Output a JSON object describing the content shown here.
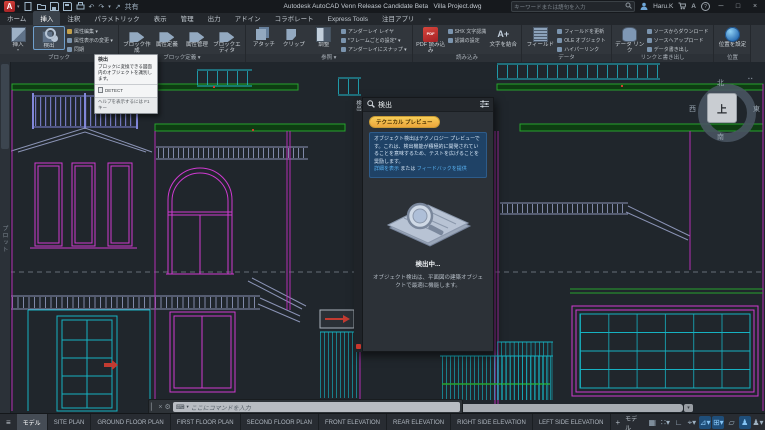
{
  "titlebar": {
    "logo": "A",
    "title": "Autodesk AutoCAD Venn Release Candidate Beta",
    "doc": "Villa Project.dwg",
    "share_label": "共有",
    "search_placeholder": "キーワードまたは語句を入力",
    "user": "Haru.K",
    "undo_glyph": "↶",
    "redo_glyph": "↷",
    "caret": "▾",
    "help_glyph": "?",
    "min_glyph": "─",
    "max_glyph": "□",
    "close_glyph": "×"
  },
  "ribbon_tabs": [
    "ホーム",
    "挿入",
    "注釈",
    "パラメトリック",
    "表示",
    "管理",
    "出力",
    "アドイン",
    "コラボレート",
    "Express Tools",
    "注目アプリ"
  ],
  "ribbon": {
    "groups": [
      {
        "label": "ブロック",
        "big": [
          "挿入",
          "検出"
        ],
        "stack": [
          "属性編集 ▾",
          "属性表示の変更 ▾",
          "同期"
        ]
      },
      {
        "label": "ブロック定義 ▾",
        "big": [
          "ブロック作成",
          "属性定義",
          "属性管理",
          "ブロックエディタ"
        ]
      },
      {
        "label": "参照 ▾",
        "big": [
          "アタッチ",
          "クリップ",
          "調整"
        ],
        "stack": [
          "アンダーレイ レイヤ",
          "*フレームごとの設定* ▾",
          "アンダーレイにスナップ ▾"
        ]
      },
      {
        "label": "読み込み",
        "big": [
          "PDF 読み込み",
          "文字を結合"
        ],
        "stack": [
          "SHX 文字認識",
          "認識の設定",
          ""
        ]
      },
      {
        "label": "データ",
        "big": [
          "フィールド"
        ],
        "stack": [
          "フィールドを更新",
          "OLE オブジェクト",
          "ハイパーリンク"
        ]
      },
      {
        "label": "リンクと書き出し",
        "big": [
          "データ リンク"
        ],
        "stack": [
          "ソースからダウンロード",
          "ソースへアップロード",
          "データ書き出し"
        ]
      },
      {
        "label": "位置",
        "big": [
          "位置を設定"
        ]
      }
    ],
    "pdf_icon_label": "PDF",
    "combine_icon_glyph": "A+"
  },
  "tooltip": {
    "title": "検出",
    "description": "ブロックに変換できる図面内のオブジェクトを識別します。",
    "command": "DETECT",
    "help": "ヘルプを表示するには F1 キー"
  },
  "panel": {
    "tab": "検出",
    "title": "検出",
    "badge": "テクニカル プレビュー",
    "info": "オブジェクト検出はテクノロジー プレビューです。これは、検出機能が積極的に開発されていることを意味するため、テストを広げることを奨励します。",
    "link1": "詳細を表示",
    "link_sep": " または ",
    "link2": "フィードバックを提供",
    "status": "検出中...",
    "description": "オブジェクト検出は、平面図の建築オブジェクトで最適に機能します。"
  },
  "viewcube": {
    "north": "北",
    "south": "南",
    "west": "西",
    "east": "東",
    "top": "上",
    "mini": "▪▪"
  },
  "left_strip_label": "プロット",
  "command_line": {
    "placeholder": "ここにコマンドを入力",
    "kbd_glyph": "⌨",
    "caret": "▾",
    "grip": "▏",
    "close": "×",
    "wrench": "⚙"
  },
  "layout_tabs": {
    "items": [
      "モデル",
      "SITE PLAN",
      "GROUND FLOOR PLAN",
      "FIRST FLOOR PLAN",
      "SECOND FLOOR PLAN",
      "FRONT ELEVATION",
      "REAR ELEVATION",
      "RIGHT SIDE ELEVATION",
      "LEFT SIDE ELEVATION"
    ],
    "add": "+",
    "burger": "≡"
  },
  "status_bar": {
    "model_label": "モデル",
    "icons": [
      {
        "name": "grid-icon",
        "g": "▦"
      },
      {
        "name": "snap-mode-icon",
        "g": "∷▾"
      },
      {
        "name": "ortho-icon",
        "g": "∟"
      },
      {
        "name": "polar-tracking-icon",
        "g": "⌖▾"
      },
      {
        "name": "isodraft-icon",
        "g": "⊿▾"
      },
      {
        "name": "object-snap-icon",
        "g": "⊞▾"
      },
      {
        "name": "lineweight-icon",
        "g": "▱"
      },
      {
        "name": "annotation-visibility-icon",
        "g": "♟"
      },
      {
        "name": "autoscale-icon",
        "g": "♟▾"
      },
      {
        "name": "workspace-icon",
        "g": "⚙▾"
      },
      {
        "name": "isolate-objects-icon",
        "g": "⊕"
      },
      {
        "name": "graphics-performance-icon",
        "g": "▭"
      },
      {
        "name": "clean-screen-icon",
        "g": "▣"
      },
      {
        "name": "customization-icon",
        "g": "≡"
      }
    ]
  },
  "scrollbar_caret": "▾"
}
